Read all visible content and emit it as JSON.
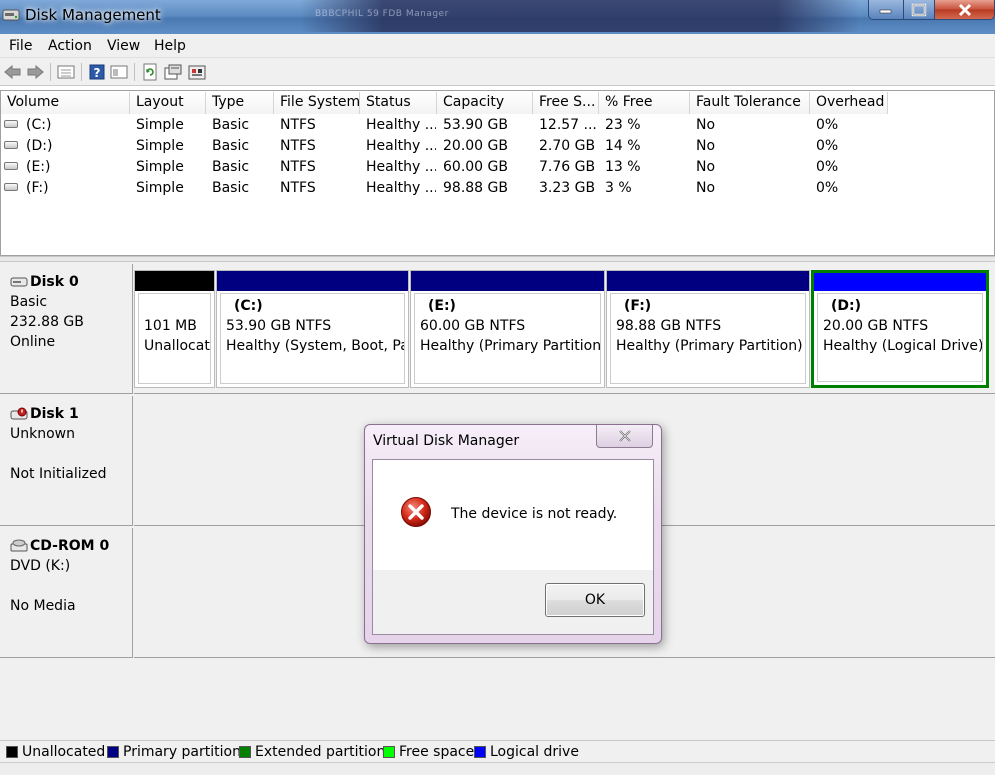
{
  "window": {
    "title": "Disk Management",
    "behind_title": "BBBCPHIL 59 FDB Manager"
  },
  "menu": [
    "File",
    "Action",
    "View",
    "Help"
  ],
  "columns": [
    "Volume",
    "Layout",
    "Type",
    "File System",
    "Status",
    "Capacity",
    "Free S...",
    "% Free",
    "Fault Tolerance",
    "Overhead"
  ],
  "volumes": [
    {
      "volume": "(C:)",
      "layout": "Simple",
      "type": "Basic",
      "fs": "NTFS",
      "status": "Healthy ...",
      "capacity": "53.90 GB",
      "free": "12.57 ...",
      "pct_free": "23 %",
      "fault": "No",
      "overhead": "0%"
    },
    {
      "volume": "(D:)",
      "layout": "Simple",
      "type": "Basic",
      "fs": "NTFS",
      "status": "Healthy ...",
      "capacity": "20.00 GB",
      "free": "2.70 GB",
      "pct_free": "14 %",
      "fault": "No",
      "overhead": "0%"
    },
    {
      "volume": "(E:)",
      "layout": "Simple",
      "type": "Basic",
      "fs": "NTFS",
      "status": "Healthy ...",
      "capacity": "60.00 GB",
      "free": "7.76 GB",
      "pct_free": "13 %",
      "fault": "No",
      "overhead": "0%"
    },
    {
      "volume": "(F:)",
      "layout": "Simple",
      "type": "Basic",
      "fs": "NTFS",
      "status": "Healthy ...",
      "capacity": "98.88 GB",
      "free": "3.23 GB",
      "pct_free": "3 %",
      "fault": "No",
      "overhead": "0%"
    }
  ],
  "disks": {
    "disk0": {
      "name": "Disk 0",
      "type": "Basic",
      "size": "232.88 GB",
      "status": "Online"
    },
    "disk1": {
      "name": "Disk 1",
      "type": "Unknown",
      "status": "Not Initialized"
    },
    "cdrom0": {
      "name": "CD-ROM 0",
      "type": "DVD (K:)",
      "status": "No Media"
    }
  },
  "partitions": [
    {
      "name": "",
      "size": "101 MB",
      "status": "Unallocate",
      "bar_color": "#000000"
    },
    {
      "name": "(C:)",
      "size": "53.90 GB NTFS",
      "status": "Healthy (System, Boot, Pag",
      "bar_color": "#000080"
    },
    {
      "name": "(E:)",
      "size": "60.00 GB NTFS",
      "status": "Healthy (Primary Partition)",
      "bar_color": "#000080"
    },
    {
      "name": "(F:)",
      "size": "98.88 GB NTFS",
      "status": "Healthy (Primary Partition)",
      "bar_color": "#000080"
    },
    {
      "name": "(D:)",
      "size": "20.00 GB NTFS",
      "status": "Healthy (Logical Drive)",
      "bar_color": "#0000ff",
      "selected": true,
      "extended_border": "#008000"
    }
  ],
  "legend": [
    {
      "label": "Unallocated",
      "color": "#000000"
    },
    {
      "label": "Primary partition",
      "color": "#000080"
    },
    {
      "label": "Extended partition",
      "color": "#008000"
    },
    {
      "label": "Free space",
      "color": "#00ff00"
    },
    {
      "label": "Logical drive",
      "color": "#0000ff"
    }
  ],
  "dialog": {
    "title": "Virtual Disk Manager",
    "message": "The device is not ready.",
    "ok_label": "OK",
    "icon": "error-icon"
  },
  "icons": {
    "toolbar": [
      "back-icon",
      "forward-icon",
      "list-icon",
      "help-icon",
      "panel-icon",
      "refresh-icon",
      "properties-icon",
      "settings-icon"
    ]
  }
}
